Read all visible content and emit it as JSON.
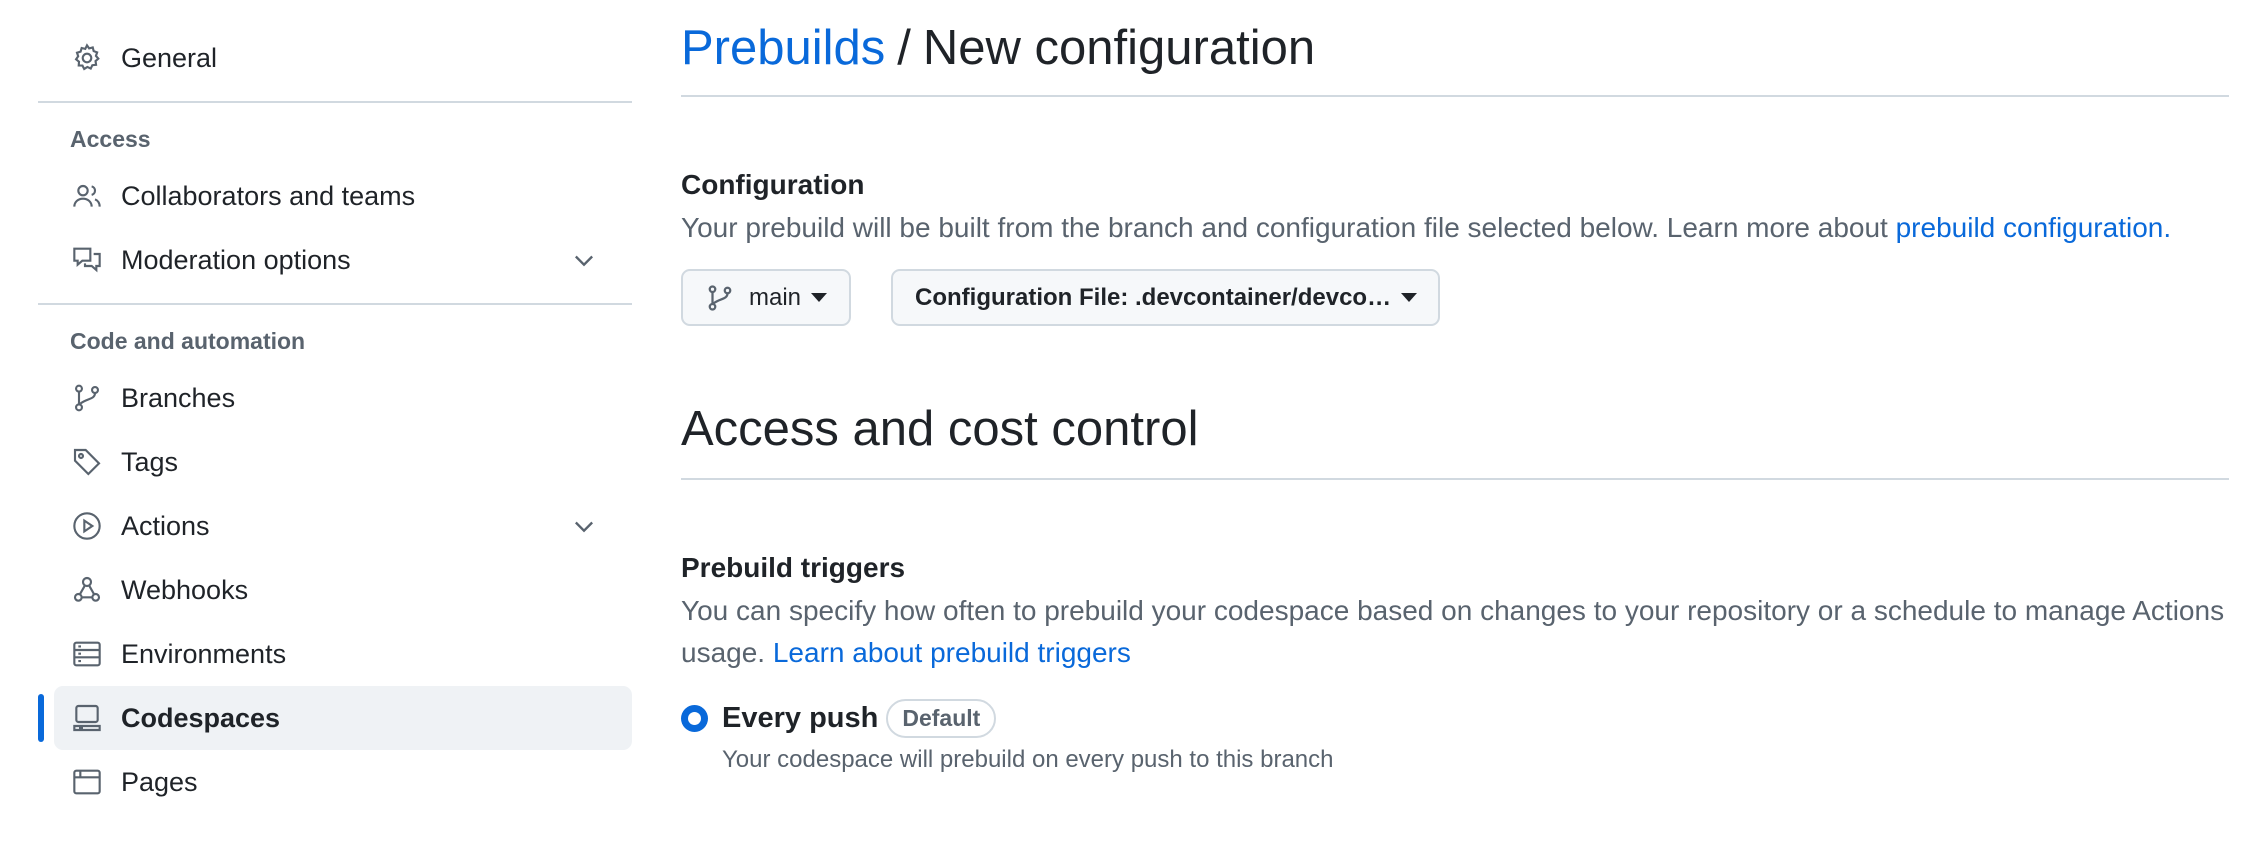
{
  "sidebar": {
    "general": "General",
    "access_heading": "Access",
    "access_items": [
      {
        "label": "Collaborators and teams",
        "icon": "people-icon"
      },
      {
        "label": "Moderation options",
        "icon": "comment-discussion-icon",
        "expandable": true
      }
    ],
    "code_heading": "Code and automation",
    "code_items": [
      {
        "label": "Branches",
        "icon": "git-branch-icon"
      },
      {
        "label": "Tags",
        "icon": "tag-icon"
      },
      {
        "label": "Actions",
        "icon": "play-icon",
        "expandable": true
      },
      {
        "label": "Webhooks",
        "icon": "webhook-icon"
      },
      {
        "label": "Environments",
        "icon": "server-icon"
      },
      {
        "label": "Codespaces",
        "icon": "codespaces-icon",
        "active": true
      },
      {
        "label": "Pages",
        "icon": "browser-icon"
      }
    ]
  },
  "main": {
    "breadcrumb_link": "Prebuilds",
    "breadcrumb_sep": "/",
    "breadcrumb_current": "New configuration",
    "configuration": {
      "heading": "Configuration",
      "description": "Your prebuild will be built from the branch and configuration file selected below. Learn more about ",
      "link": "prebuild configuration.",
      "branch_button": "main",
      "config_button": "Configuration File: .devcontainer/devco…"
    },
    "access_title": "Access and cost control",
    "triggers": {
      "heading": "Prebuild triggers",
      "description": "You can specify how often to prebuild your codespace based on changes to your repository or a schedule to manage Actions usage. ",
      "link": "Learn about prebuild triggers",
      "option_label": "Every push",
      "option_badge": "Default",
      "option_desc": "Your codespace will prebuild on every push to this branch",
      "option_selected": true
    }
  },
  "colors": {
    "accent": "#0969da",
    "muted": "#59636e",
    "border": "#d1d9e0"
  }
}
